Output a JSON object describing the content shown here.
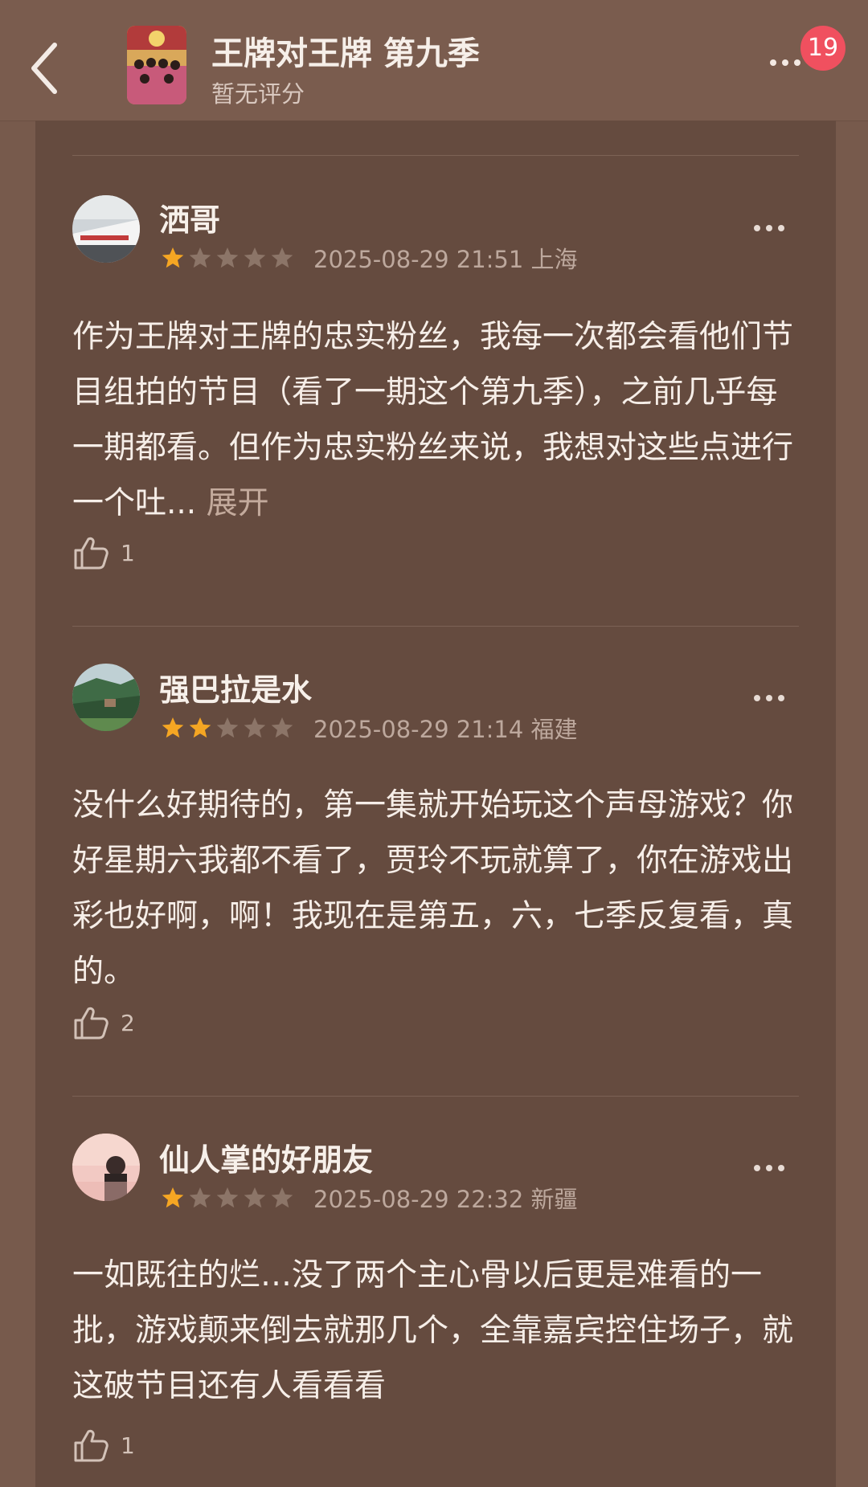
{
  "header": {
    "title": "王牌对王牌 第九季",
    "subtitle": "暂无评分",
    "badge_count": "19"
  },
  "reviews": [
    {
      "username": "洒哥",
      "rating": 1,
      "meta": "2025-08-29 21:51 上海",
      "text": "作为王牌对王牌的忠实粉丝，我每一次都会看他们节目组拍的节目（看了一期这个第九季），之前几乎每一期都看。但作为忠实粉丝来说，我想对这些点进行一个吐...",
      "expand_label": "展开",
      "likes": "1"
    },
    {
      "username": "强巴拉是水",
      "rating": 2,
      "meta": "2025-08-29 21:14 福建",
      "text": "没什么好期待的，第一集就开始玩这个声母游戏？你好星期六我都不看了，贾玲不玩就算了，你在游戏出彩也好啊，啊！我现在是第五，六，七季反复看，真的。",
      "expand_label": "",
      "likes": "2"
    },
    {
      "username": "仙人掌的好朋友",
      "rating": 1,
      "meta": "2025-08-29 22:32 新疆",
      "text": "一如既往的烂…没了两个主心骨以后更是难看的一批，游戏颠来倒去就那几个，全靠嘉宾控住场子，就这破节目还有人看看看",
      "expand_label": "",
      "likes": "1"
    }
  ],
  "colors": {
    "star_on": "#f5a623",
    "star_off": "#8c7568",
    "background": "#654b3f"
  }
}
